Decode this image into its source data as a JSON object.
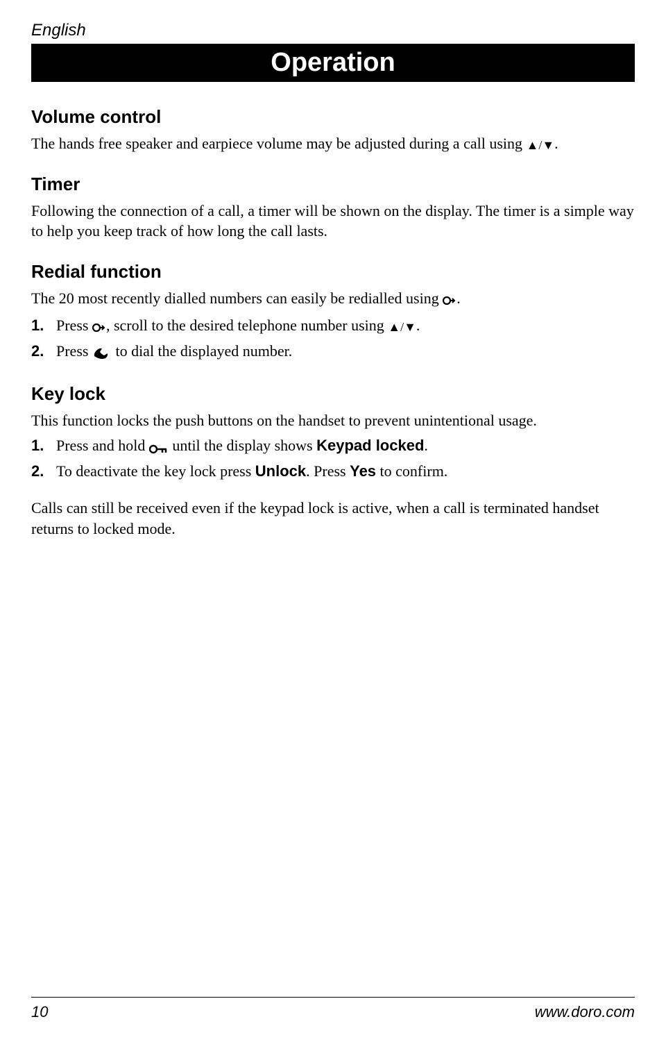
{
  "header": {
    "language": "English",
    "title": "Operation"
  },
  "sections": {
    "volume": {
      "heading": "Volume control",
      "text_before": "The hands free speaker and earpiece volume may be adjusted during a call using ",
      "text_after": "."
    },
    "timer": {
      "heading": "Timer",
      "text": "Following the connection of a call, a timer will be shown on the display. The timer is a simple way to help you keep track of how long the call lasts."
    },
    "redial": {
      "heading": "Redial function",
      "intro_before": "The 20 most recently dialled numbers can easily be redialled using ",
      "intro_after": ".",
      "num1": "1.",
      "item1_a": "Press ",
      "item1_b": ", scroll to the desired telephone number using ",
      "item1_c": ".",
      "num2": "2.",
      "item2_a": "Press ",
      "item2_b": " to dial the displayed number."
    },
    "keylock": {
      "heading": "Key lock",
      "intro": "This function locks the push buttons on the handset to prevent unintentional usage.",
      "num1": "1.",
      "item1_a": "Press and hold ",
      "item1_b": " until the display shows ",
      "item1_bold": "Keypad locked",
      "item1_c": ".",
      "num2": "2.",
      "item2_a": "To deactivate the key lock press ",
      "item2_bold1": "Unlock",
      "item2_b": ". Press ",
      "item2_bold2": "Yes",
      "item2_c": " to confirm.",
      "note": "Calls can still be received even if the keypad lock is active, when a call is terminated handset returns to locked mode."
    }
  },
  "footer": {
    "page": "10",
    "url": "www.doro.com"
  }
}
